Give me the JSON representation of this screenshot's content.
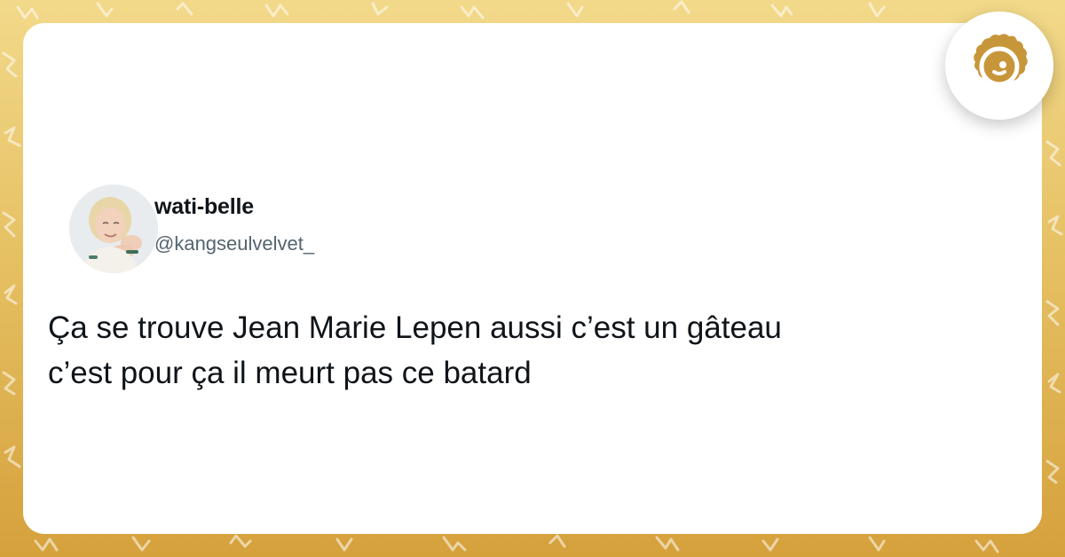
{
  "tweet": {
    "display_name": "wati-belle",
    "handle": "@kangseulvelvet_",
    "text": "Ça se trouve Jean Marie Lepen aussi c’est un gâteau\nc’est pour ça il meurt pas ce batard"
  },
  "brand": {
    "icon": "cookie-logo-icon",
    "color": "#c8963a"
  },
  "colors": {
    "background": "#e2bb52",
    "card": "#ffffff",
    "text_primary": "#0f1419",
    "text_secondary": "#536471"
  }
}
